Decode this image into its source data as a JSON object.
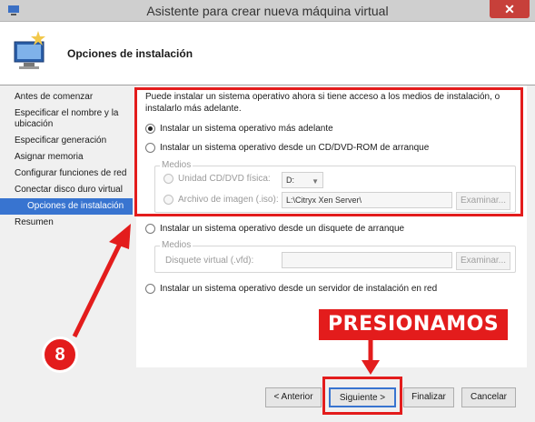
{
  "window": {
    "title": "Asistente para crear nueva máquina virtual",
    "close_glyph": "✕"
  },
  "header": {
    "title": "Opciones de instalación",
    "icon": "wizard-monitor-icon"
  },
  "steps": [
    {
      "label": "Antes de comenzar",
      "active": false
    },
    {
      "label": "Especificar el nombre y la ubicación",
      "active": false
    },
    {
      "label": "Especificar generación",
      "active": false
    },
    {
      "label": "Asignar memoria",
      "active": false
    },
    {
      "label": "Configurar funciones de red",
      "active": false
    },
    {
      "label": "Conectar disco duro virtual",
      "active": false
    },
    {
      "label": "Opciones de instalación",
      "active": true
    },
    {
      "label": "Resumen",
      "active": false
    }
  ],
  "main": {
    "intro": "Puede instalar un sistema operativo ahora si tiene acceso a los medios de instalación, o instalarlo más adelante.",
    "options": {
      "later": {
        "label": "Instalar un sistema operativo más adelante",
        "selected": true
      },
      "cd": {
        "label": "Instalar un sistema operativo desde un CD/DVD-ROM de arranque",
        "selected": false
      },
      "floppy": {
        "label": "Instalar un sistema operativo desde un disquete de arranque",
        "selected": false
      },
      "network": {
        "label": "Instalar un sistema operativo desde un servidor de instalación en red",
        "selected": false
      }
    },
    "cd_group": {
      "legend": "Medios",
      "physical_label": "Unidad CD/DVD física:",
      "physical_value": "D:",
      "image_label": "Archivo de imagen (.iso):",
      "image_value": "L:\\Citryx Xen Server\\",
      "browse": "Examinar..."
    },
    "floppy_group": {
      "legend": "Medios",
      "virtual_label": "Disquete virtual (.vfd):",
      "virtual_value": "",
      "browse": "Examinar..."
    }
  },
  "buttons": {
    "back": "< Anterior",
    "next": "Siguiente >",
    "finish": "Finalizar",
    "cancel": "Cancelar"
  },
  "annotations": {
    "banner": "PRESIONAMOS",
    "step_number": "8",
    "color": "#e31c1c"
  }
}
